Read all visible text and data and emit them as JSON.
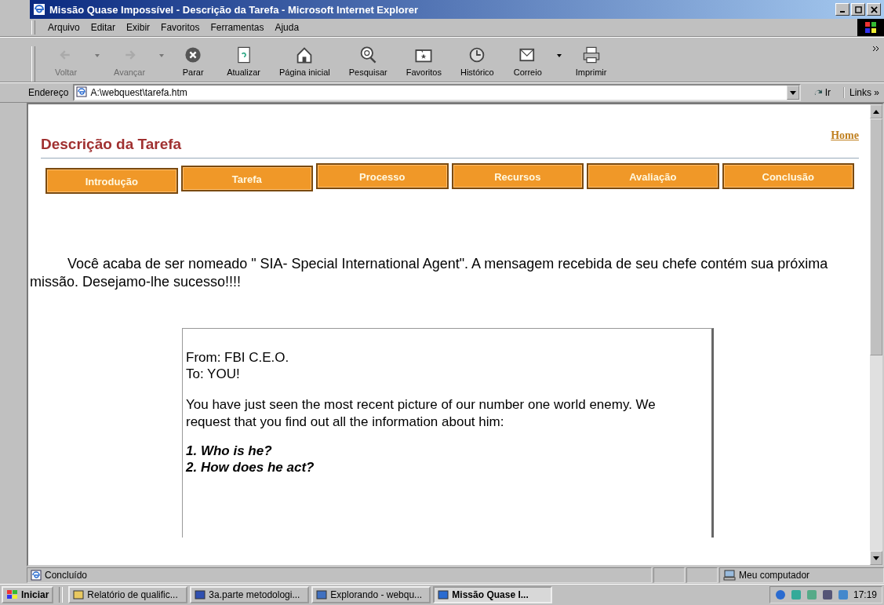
{
  "window": {
    "title": "Missão Quase Impossível - Descrição da Tarefa - Microsoft Internet Explorer"
  },
  "menu": [
    "Arquivo",
    "Editar",
    "Exibir",
    "Favoritos",
    "Ferramentas",
    "Ajuda"
  ],
  "toolbar": [
    {
      "label": "Voltar",
      "kind": "back",
      "disabled": true,
      "dropdown": true
    },
    {
      "label": "Avançar",
      "kind": "forward",
      "disabled": true,
      "dropdown": true
    },
    {
      "label": "Parar",
      "kind": "stop",
      "disabled": false,
      "dropdown": false
    },
    {
      "label": "Atualizar",
      "kind": "refresh",
      "disabled": false,
      "dropdown": false
    },
    {
      "label": "Página inicial",
      "kind": "home",
      "disabled": false,
      "dropdown": false
    },
    {
      "label": "Pesquisar",
      "kind": "search",
      "disabled": false,
      "dropdown": false
    },
    {
      "label": "Favoritos",
      "kind": "favorites",
      "disabled": false,
      "dropdown": false
    },
    {
      "label": "Histórico",
      "kind": "history",
      "disabled": false,
      "dropdown": false
    },
    {
      "label": "Correio",
      "kind": "mail",
      "disabled": false,
      "dropdown": true
    },
    {
      "label": "Imprimir",
      "kind": "print",
      "disabled": false,
      "dropdown": false
    }
  ],
  "address": {
    "label": "Endereço",
    "value": "A:\\webquest\\tarefa.htm",
    "go": "Ir",
    "links": "Links »"
  },
  "page": {
    "heading": "Descrição da Tarefa",
    "home_link": "Home",
    "nav": [
      "Introdução",
      "Tarefa",
      "Processo",
      "Recursos",
      "Avaliação",
      "Conclusão"
    ],
    "intro": "Você acaba de ser nomeado \" SIA- Special International Agent\". A mensagem recebida de seu chefe contém sua próxima missão. Desejamo-lhe sucesso!!!!",
    "message": {
      "from": "From: FBI  C.E.O.",
      "to": "To: YOU!",
      "body": "You have just seen the most recent picture of our number one world enemy. We request that you find out all the information about him:",
      "questions": [
        "1. Who is he?",
        "2. How does he act?"
      ]
    }
  },
  "status_bar": {
    "text": "Concluído",
    "zone": "Meu computador"
  },
  "taskbar": {
    "start": "Iniciar",
    "tasks": [
      {
        "label": "Relatório de qualific...",
        "selected": false
      },
      {
        "label": "3a.parte metodologi...",
        "selected": false
      },
      {
        "label": "Explorando - webqu...",
        "selected": false
      },
      {
        "label": "Missão Quase I...",
        "selected": true
      }
    ],
    "clock": "17:19"
  }
}
